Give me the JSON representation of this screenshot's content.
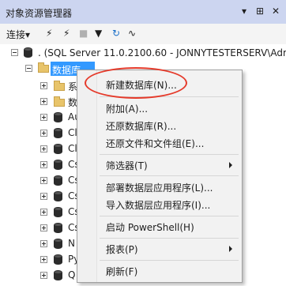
{
  "panel": {
    "title": "对象资源管理器",
    "pin_glyph": "▾ ⊞ ✕"
  },
  "toolbar": {
    "connect_label": "连接",
    "connect_caret": "▾"
  },
  "tree": {
    "server_label": ". (SQL Server 11.0.2100.60 - JONNYTESTERSERV\\Adm",
    "databases_label": "数据库",
    "children": [
      {
        "label": "系",
        "kind": "folder"
      },
      {
        "label": "数",
        "kind": "folder"
      },
      {
        "label": "Au",
        "kind": "db"
      },
      {
        "label": "Cl",
        "kind": "db"
      },
      {
        "label": "Cl",
        "kind": "db"
      },
      {
        "label": "Cs",
        "kind": "db"
      },
      {
        "label": "Cs",
        "kind": "db"
      },
      {
        "label": "Cs",
        "kind": "db"
      },
      {
        "label": "Cs",
        "kind": "db"
      },
      {
        "label": "Cs",
        "kind": "db"
      },
      {
        "label": "N",
        "kind": "db"
      },
      {
        "label": "Py",
        "kind": "db"
      },
      {
        "label": "Q",
        "kind": "db"
      }
    ]
  },
  "context_menu": {
    "items": [
      {
        "label": "新建数据库(N)..."
      },
      {
        "label": "附加(A)..."
      },
      {
        "label": "还原数据库(R)..."
      },
      {
        "label": "还原文件和文件组(E)..."
      },
      {
        "label": "筛选器(T)",
        "submenu": true
      },
      {
        "label": "部署数据层应用程序(L)..."
      },
      {
        "label": "导入数据层应用程序(I)..."
      },
      {
        "label": "启动 PowerShell(H)"
      },
      {
        "label": "报表(P)",
        "submenu": true
      },
      {
        "label": "刷新(F)"
      }
    ]
  },
  "colors": {
    "titlebar": "#ccd5f0",
    "selection": "#3399ff",
    "annotation": "#e53a2a"
  }
}
